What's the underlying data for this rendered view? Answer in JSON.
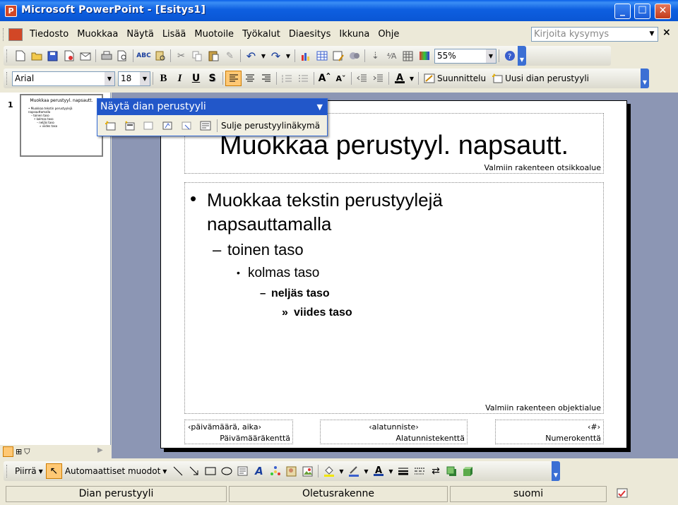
{
  "window": {
    "title": "Microsoft PowerPoint - [Esitys1]",
    "app_icon_letter": "P",
    "min_label": "_",
    "max_label": "☐",
    "close_label": "✕"
  },
  "menubar": {
    "items": [
      "Tiedosto",
      "Muokkaa",
      "Näytä",
      "Lisää",
      "Muotoile",
      "Työkalut",
      "Diaesitys",
      "Ikkuna",
      "Ohje"
    ],
    "help_placeholder": "Kirjoita kysymys",
    "close_doc_label": "×"
  },
  "standard_toolbar": {
    "zoom": "55%"
  },
  "format_toolbar": {
    "font": "Arial",
    "size": "18",
    "bold": "B",
    "italic": "I",
    "underline": "U",
    "shadow": "S",
    "design_label": "Suunnittelu",
    "new_master_label": "Uusi dian perustyyli"
  },
  "master_toolbar": {
    "title": "Näytä dian perustyyli",
    "close_label": "Sulje perustyylinäkymä"
  },
  "slides_pane": {
    "slide_number": "1",
    "thumb_title": "Muokkaa perustyyl. napsautt.",
    "thumb_lines": [
      "• Muokkaa tekstin perustyylejä",
      "napsauttamalla",
      "– toinen taso",
      "• kolmas taso",
      "– neljäs taso",
      "» viides taso"
    ]
  },
  "slide": {
    "title": "Muokkaa perustyyl. napsautt.",
    "title_area_label": "Valmiin rakenteen otsikkoalue",
    "body": {
      "level1": "Muokkaa tekstin perustyylejä napsauttamalla",
      "level1_bullet": "•",
      "level2": "toinen taso",
      "level2_bullet": "–",
      "level3": "kolmas taso",
      "level3_bullet": "•",
      "level4": "neljäs taso",
      "level4_bullet": "–",
      "level5": "viides taso",
      "level5_bullet": "»"
    },
    "object_area_label": "Valmiin rakenteen objektialue",
    "footer": {
      "date_text": "‹päivämäärä, aika›",
      "date_label": "Päivämääräkenttä",
      "footer_text": "‹alatunniste›",
      "footer_label": "Alatunnistekenttä",
      "number_text": "‹#›",
      "number_label": "Numerokenttä"
    }
  },
  "drawing_toolbar": {
    "draw_label": "Piirrä",
    "autoshapes_label": "Automaattiset muodot"
  },
  "statusbar": {
    "view": "Dian perustyyli",
    "design": "Oletusrakenne",
    "language": "suomi"
  }
}
